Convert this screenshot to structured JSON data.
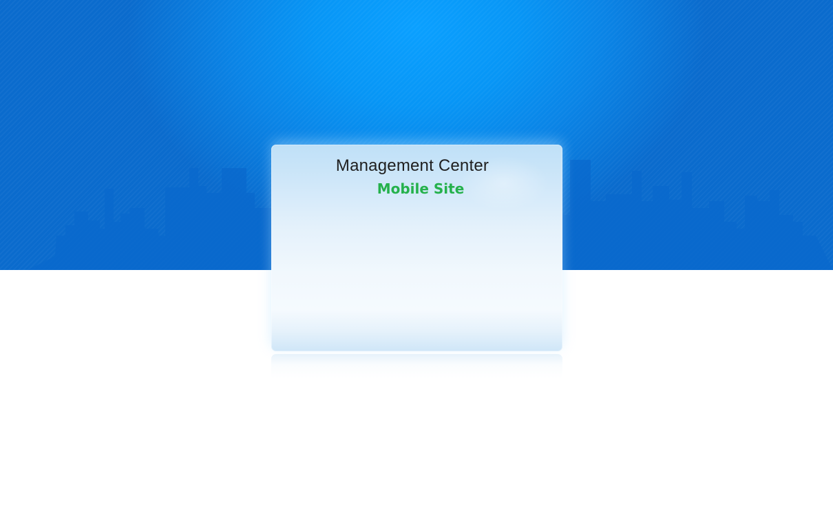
{
  "colors": {
    "banner_blue": "#0a84e6",
    "title": "#1f1f1f",
    "subtitle_green": "#25b14c"
  },
  "login_panel": {
    "title": "Management Center",
    "subtitle": "Mobile Site"
  }
}
